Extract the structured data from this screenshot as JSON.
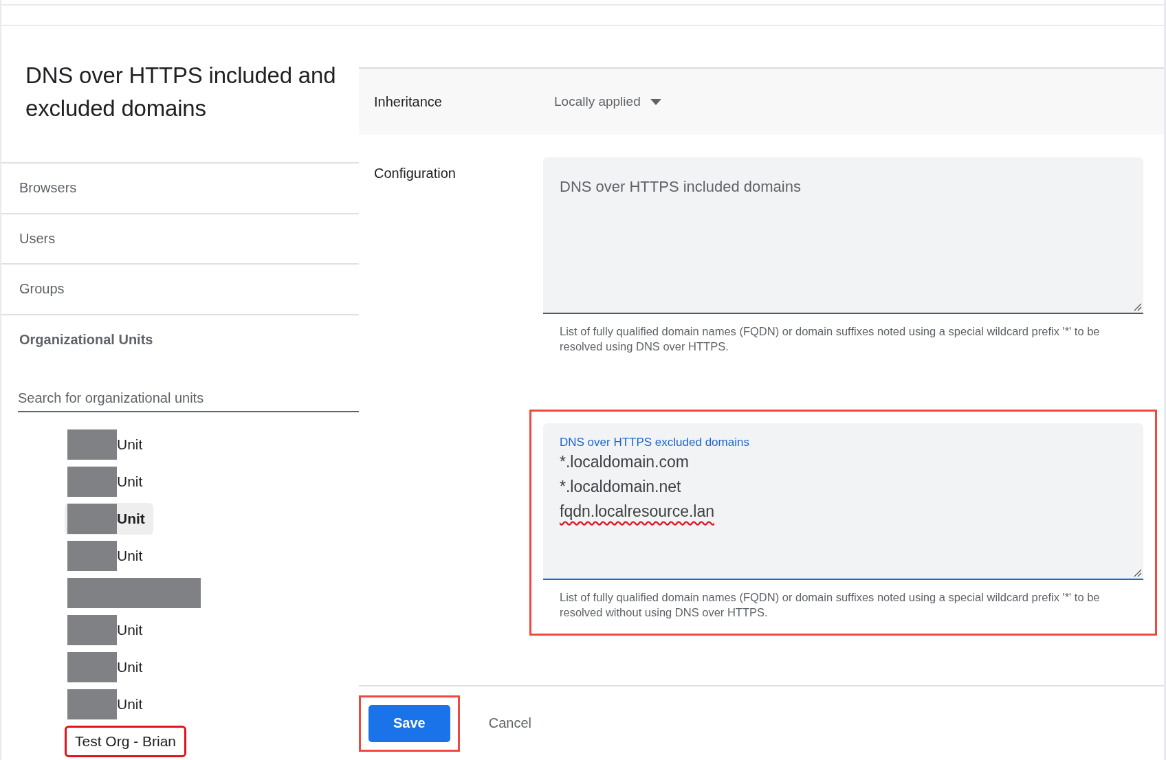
{
  "title": "DNS over HTTPS included and excluded domains",
  "nav": [
    {
      "label": "Browsers",
      "selected": false
    },
    {
      "label": "Users",
      "selected": false
    },
    {
      "label": "Groups",
      "selected": false
    },
    {
      "label": "Organizational Units",
      "selected": true
    }
  ],
  "search": {
    "placeholder": "Search for organizational units"
  },
  "tree": [
    {
      "label": "Unit",
      "redacted": true,
      "selected": false,
      "highlighted": false
    },
    {
      "label": "Unit",
      "redacted": true,
      "selected": false,
      "highlighted": false
    },
    {
      "label": "Unit",
      "redacted": true,
      "selected": true,
      "highlighted": false
    },
    {
      "label": "Unit",
      "redacted": true,
      "selected": false,
      "highlighted": false
    },
    {
      "redacted": true,
      "selected": false,
      "highlighted": false
    },
    {
      "label": "Unit",
      "redacted": true,
      "selected": false,
      "highlighted": false
    },
    {
      "label": "Unit",
      "redacted": true,
      "selected": false,
      "highlighted": false
    },
    {
      "label": "Unit",
      "redacted": true,
      "selected": false,
      "highlighted": false
    },
    {
      "label": "Test Org - Brian",
      "redacted": false,
      "selected": false,
      "highlighted": true
    }
  ],
  "inheritance": {
    "label": "Inheritance",
    "value": "Locally applied"
  },
  "configuration": {
    "label": "Configuration",
    "fields": [
      {
        "label": "DNS over HTTPS included domains",
        "focused": false,
        "highlighted": false,
        "helper": "List of fully qualified domain names (FQDN) or domain suffixes noted using a special wildcard prefix '*' to be resolved using DNS over HTTPS."
      },
      {
        "label": "DNS over HTTPS excluded domains",
        "focused": true,
        "highlighted": true,
        "lines": [
          {
            "text": "*.localdomain.com",
            "misspelled": false
          },
          {
            "text": "*.localdomain.net",
            "misspelled": false
          },
          {
            "text": "fqdn.localresource.lan",
            "misspelled": true
          }
        ],
        "helper": "List of fully qualified domain names (FQDN) or domain suffixes noted using a special wildcard prefix '*' to be resolved without using DNS over HTTPS."
      }
    ]
  },
  "buttons": [
    {
      "label": "Save",
      "kind": "primary",
      "highlighted": true
    },
    {
      "label": "Cancel",
      "kind": "text",
      "highlighted": false
    }
  ]
}
